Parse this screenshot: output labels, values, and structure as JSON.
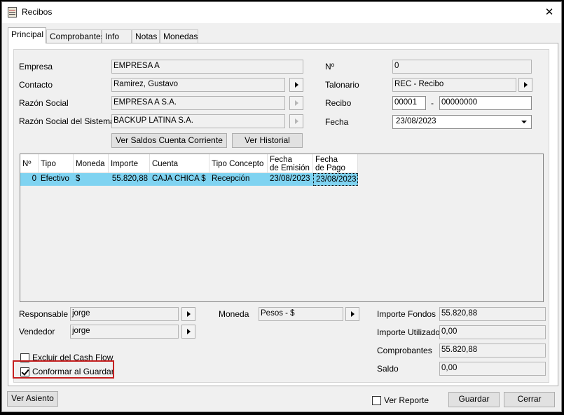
{
  "window": {
    "title": "Recibos",
    "close_glyph": "✕"
  },
  "tabs": [
    "Principal",
    "Comprobantes",
    "Info",
    "Notas",
    "Monedas"
  ],
  "form": {
    "empresa_label": "Empresa",
    "empresa_value": "EMPRESA A",
    "contacto_label": "Contacto",
    "contacto_value": "Ramirez, Gustavo",
    "razon_label": "Razón Social",
    "razon_value": "EMPRESA A S.A.",
    "razon_sistema_label": "Razón Social del Sistema",
    "razon_sistema_value": "BACKUP LATINA S.A.",
    "numero_label": "Nº",
    "numero_value": "0",
    "talonario_label": "Talonario",
    "talonario_value": "REC - Recibo",
    "recibo_label": "Recibo",
    "recibo_punto": "00001",
    "recibo_sep": "-",
    "recibo_numero": "00000000",
    "fecha_label": "Fecha",
    "fecha_value": "23/08/2023",
    "saldos_button": "Ver Saldos Cuenta Corriente",
    "historial_button": "Ver Historial"
  },
  "grid": {
    "headers": [
      "Nº",
      "Tipo",
      "Moneda",
      "Importe",
      "Cuenta",
      "Tipo Concepto",
      "Fecha\nde Emisión",
      "Fecha\nde Pago"
    ],
    "rows": [
      [
        "0",
        "Efectivo",
        "$",
        "55.820,88",
        "CAJA CHICA $",
        "Recepción",
        "23/08/2023",
        "23/08/2023"
      ]
    ]
  },
  "bottom": {
    "responsable_label": "Responsable",
    "responsable_value": "jorge",
    "vendedor_label": "Vendedor",
    "vendedor_value": "jorge",
    "moneda_label": "Moneda",
    "moneda_value": "Pesos - $",
    "importe_fondos_label": "Importe Fondos",
    "importe_fondos_value": "55.820,88",
    "importe_utilizado_label": "Importe Utilizado",
    "importe_utilizado_value": "0,00",
    "comprobantes_label": "Comprobantes",
    "comprobantes_value": "55.820,88",
    "saldo_label": "Saldo",
    "saldo_value": "0,00",
    "excluir_label": "Excluir del Cash Flow",
    "excluir_checked": false,
    "conformar_label": "Conformar al Guardar",
    "conformar_checked": true
  },
  "footer": {
    "ver_asiento": "Ver Asiento",
    "ver_reporte": "Ver Reporte",
    "ver_reporte_checked": false,
    "guardar": "Guardar",
    "cerrar": "Cerrar"
  },
  "colors": {
    "selected_row": "#7fd3f1",
    "highlight_border": "#c42020"
  }
}
